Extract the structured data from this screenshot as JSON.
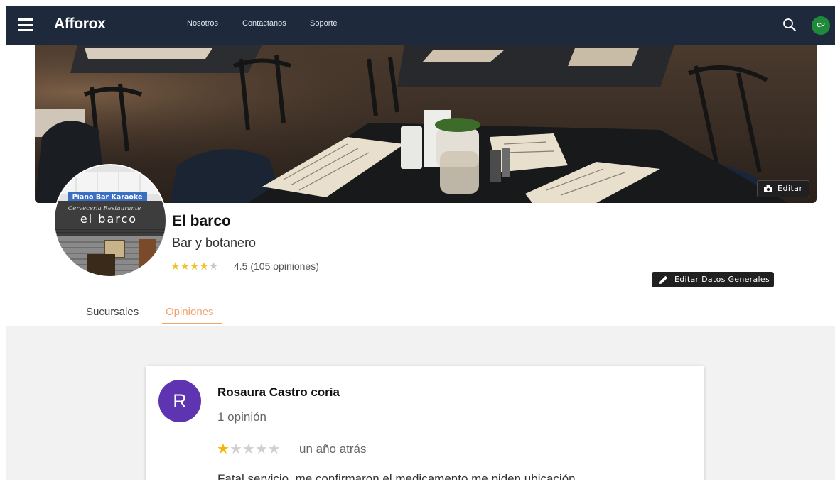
{
  "topbar": {
    "brand": "Afforox",
    "nav": [
      "Nosotros",
      "Contactanos",
      "Soporte"
    ],
    "user_initials": "CP",
    "icons": {
      "menu": "hamburger-icon",
      "search": "search-icon"
    }
  },
  "cover": {
    "edit_label": "Editar",
    "edit_icon": "camera-icon"
  },
  "profile": {
    "sign_lines": [
      "Piano Bar Karaoke",
      "Cerveceria Restaurante",
      "el barco"
    ],
    "name": "El barco",
    "category": "Bar y botanero",
    "rating": 4.5,
    "rating_text": "4.5 (105 opiniones)",
    "edit_general_label": "Editar Datos Generales",
    "edit_general_icon": "pencil-icon"
  },
  "tabs": [
    {
      "label": "Sucursales",
      "active": false
    },
    {
      "label": "Opiniones",
      "active": true
    }
  ],
  "review": {
    "avatar_letter": "R",
    "author": "Rosaura Castro coria",
    "author_reviews": "1 opinión",
    "stars": 1,
    "time": "un año atrás",
    "text": "Fatal servicio, me confirmaron el medicamento me piden ubicación"
  },
  "colors": {
    "topbar": "#1e2a3c",
    "accent_tab": "#f0a36b",
    "avatar_cp": "#1f8a3a",
    "review_avatar": "#5e34b1",
    "star": "#f2c12e"
  }
}
